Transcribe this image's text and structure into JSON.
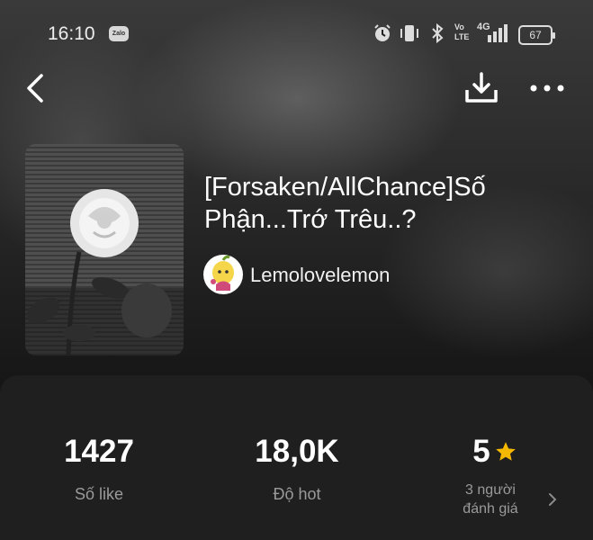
{
  "status_bar": {
    "time": "16:10",
    "notification_app": "Zalo",
    "volte_label": "Vo LTE",
    "network_label": "4G",
    "battery_level": "67"
  },
  "book": {
    "title": "[Forsaken/AllChance]Số Phận...Trớ Trêu..?",
    "author": "Lemolovelemon"
  },
  "stats": {
    "likes_value": "1427",
    "likes_label": "Số like",
    "hot_value": "18,0K",
    "hot_label": "Độ hot",
    "rating_value": "5",
    "rating_count_label": "3 người",
    "rating_suffix_label": "đánh giá"
  },
  "colors": {
    "star": "#f5b800",
    "panel_bg": "#1f1f1f",
    "muted_text": "#9a9a9a"
  },
  "icons": [
    "back-arrow-icon",
    "download-icon",
    "more-options-icon",
    "star-icon",
    "chevron-right-icon",
    "alarm-icon",
    "vibrate-icon",
    "bluetooth-icon",
    "signal-icon"
  ]
}
